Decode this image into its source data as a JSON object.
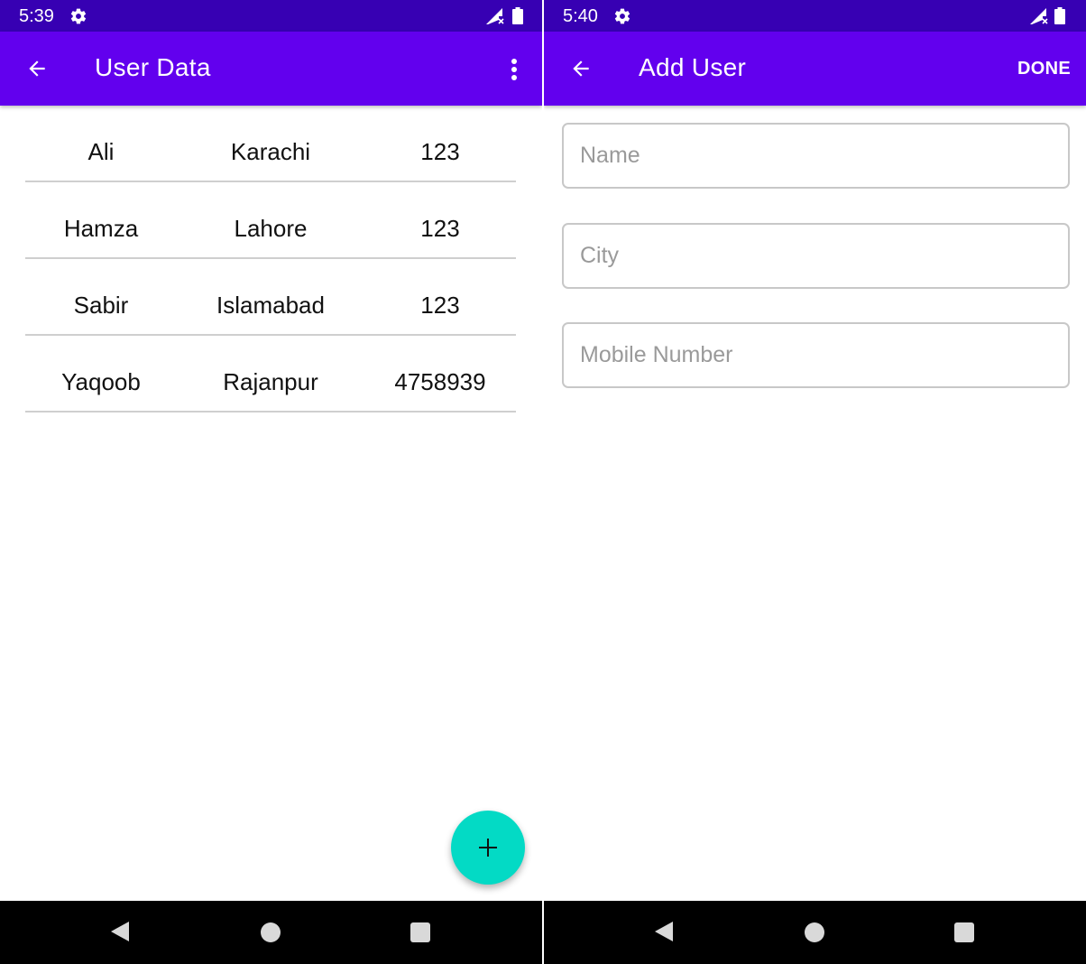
{
  "left_screen": {
    "status": {
      "time": "5:39"
    },
    "app_bar": {
      "title": "User Data"
    },
    "users": [
      {
        "name": "Ali",
        "city": "Karachi",
        "mobile": "123"
      },
      {
        "name": "Hamza",
        "city": "Lahore",
        "mobile": "123"
      },
      {
        "name": "Sabir",
        "city": "Islamabad",
        "mobile": "123"
      },
      {
        "name": "Yaqoob",
        "city": "Rajanpur",
        "mobile": "4758939"
      }
    ],
    "fab": {
      "icon": "plus-icon"
    }
  },
  "right_screen": {
    "status": {
      "time": "5:40"
    },
    "app_bar": {
      "title": "Add User",
      "action_label": "DONE"
    },
    "form": {
      "name_placeholder": "Name",
      "city_placeholder": "City",
      "mobile_placeholder": "Mobile Number"
    }
  },
  "icons": {
    "status": [
      "gear-icon",
      "signal-icon",
      "battery-icon"
    ],
    "app_bar": [
      "back-arrow-icon",
      "overflow-menu-icon"
    ],
    "nav": [
      "nav-back-icon",
      "nav-home-icon",
      "nav-recents-icon"
    ]
  },
  "colors": {
    "status_bar": "#3700b3",
    "app_bar": "#6200ee",
    "fab": "#03dac5",
    "nav_bar": "#000000",
    "divider": "#cfcfcf"
  }
}
